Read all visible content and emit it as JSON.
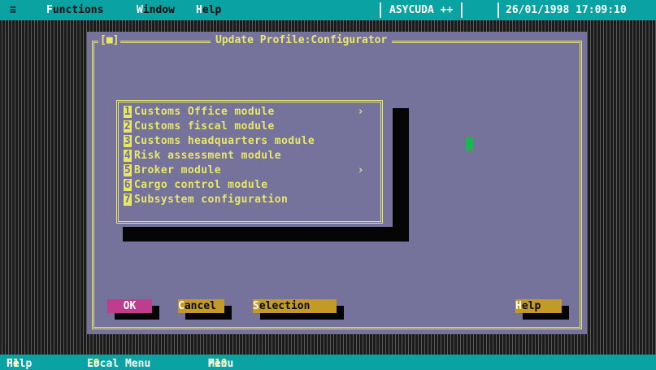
{
  "menubar": {
    "system_menu": "≡",
    "functions": {
      "hot": "F",
      "rest": "unctions"
    },
    "window": {
      "hot": "W",
      "rest": "indow"
    },
    "help": {
      "hot": "H",
      "rest": "elp"
    },
    "app_name": "ASYCUDA ++",
    "datetime": "26/01/1998 17:09:10"
  },
  "dialog": {
    "close_box": "[■]",
    "title": "Update Profile:Configurator",
    "menu_items": [
      {
        "num": "1",
        "label": "Customs Office module",
        "arrow": "›"
      },
      {
        "num": "2",
        "label": "Customs fiscal module",
        "arrow": ""
      },
      {
        "num": "3",
        "label": "Customs headquarters module",
        "arrow": ""
      },
      {
        "num": "4",
        "label": "Risk assessment module",
        "arrow": ""
      },
      {
        "num": "5",
        "label": "Broker module",
        "arrow": "›"
      },
      {
        "num": "6",
        "label": "Cargo control module",
        "arrow": ""
      },
      {
        "num": "7",
        "label": "Subsystem configuration",
        "arrow": ""
      }
    ],
    "buttons": {
      "ok": "OK",
      "cancel": {
        "hot": "C",
        "rest": "ancel"
      },
      "selection": {
        "hot": "S",
        "rest": "election"
      },
      "help": {
        "hot": "H",
        "rest": "elp"
      }
    }
  },
  "statusbar": {
    "f1": {
      "key": "F1",
      "label": "Help"
    },
    "f9": {
      "key": "F9",
      "label": "Local Menu"
    },
    "f10": {
      "key": "F10",
      "label": "Menu"
    }
  },
  "colors": {
    "menubar_bg": "#0aa2a2",
    "dialog_bg": "#75729c",
    "frame": "#e8e866",
    "button": "#c49a26",
    "button_default": "#bf3d8d",
    "cursor": "#19b84a"
  }
}
